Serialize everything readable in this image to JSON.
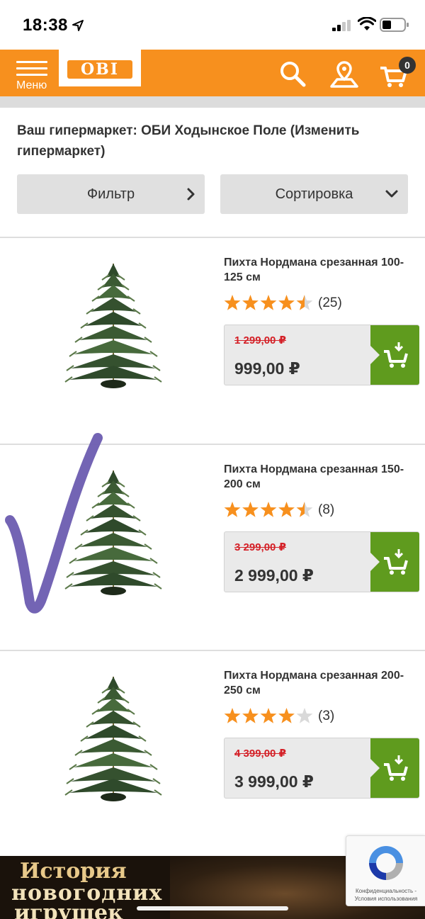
{
  "status_bar": {
    "time": "18:38",
    "icons": [
      "location-arrow-icon",
      "signal-icon",
      "wifi-icon",
      "battery-icon"
    ]
  },
  "header": {
    "menu_label": "Меню",
    "logo": "OBI",
    "cart_count": "0",
    "icons": [
      "search-icon",
      "map-pin-icon",
      "cart-icon"
    ],
    "colors": {
      "brand_orange": "#f7901e",
      "dark": "#333333"
    }
  },
  "store": {
    "text": "Ваш гипермаркет: ОБИ Ходынское Поле (Изменить гипермаркет)"
  },
  "controls": {
    "filter_label": "Фильтр",
    "sort_label": "Сортировка"
  },
  "products": [
    {
      "name": "Пихта Нордмана срезанная 100-125 см",
      "rating": 4.5,
      "reviews": "(25)",
      "old_price": "1 299,00 ₽",
      "price": "999,00 ₽"
    },
    {
      "name": "Пихта Нордмана срезанная 150-200 см",
      "rating": 4.5,
      "reviews": "(8)",
      "old_price": "3 299,00 ₽",
      "price": "2 999,00 ₽"
    },
    {
      "name": "Пихта Нордмана срезанная 200-250 см",
      "rating": 4,
      "reviews": "(3)",
      "old_price": "4 399,00 ₽",
      "price": "3 999,00 ₽"
    }
  ],
  "colors": {
    "star": "#f7901e",
    "old_price": "#d41f26",
    "cart_button": "#5f9b1e",
    "checkmark": "#6b5cb0"
  },
  "banner": {
    "line1": "История",
    "line2": "новогодних",
    "line3": "игрушек"
  },
  "recaptcha": {
    "text": "Конфиденциальность - Условия использования"
  }
}
